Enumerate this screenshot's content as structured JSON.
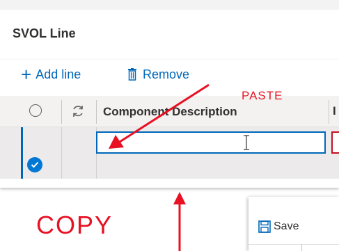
{
  "section": {
    "title": "SVOL Line"
  },
  "toolbar": {
    "add_icon": "plus-icon",
    "add_label": "Add line",
    "remove_icon": "trash-icon",
    "remove_label": "Remove"
  },
  "grid": {
    "columns": [
      {
        "type": "select-all",
        "icon": "circle-icon"
      },
      {
        "type": "refresh",
        "icon": "refresh-icon"
      },
      {
        "label": "Component Description"
      },
      {
        "label": "I"
      }
    ],
    "rows": [
      {
        "selected": true,
        "component_description": ""
      }
    ]
  },
  "annotations": {
    "paste_label": "PASTE",
    "copy_label": "COPY",
    "color": "#e81123"
  },
  "save_button": {
    "icon": "floppy-disk-icon",
    "label": "Save"
  },
  "colors": {
    "accent": "#0067b8",
    "selected": "#0078d4",
    "annotation": "#e81123"
  }
}
